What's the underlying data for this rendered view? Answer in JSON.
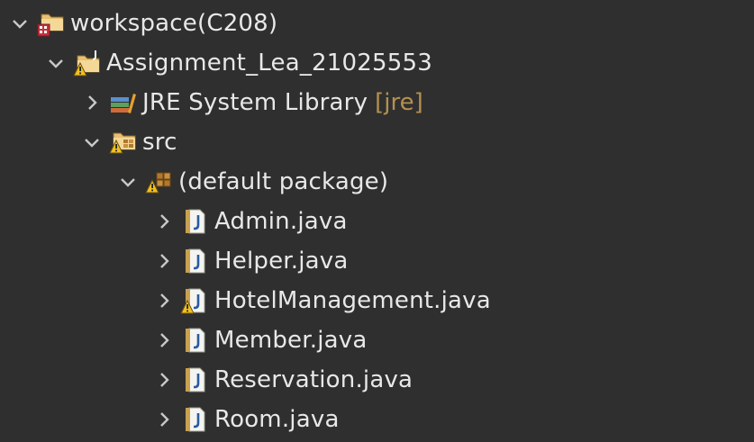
{
  "tree": {
    "workspace": {
      "label": "workspace(C208)",
      "expanded": true,
      "icon": "workspace-icon"
    },
    "project": {
      "label": "Assignment_Lea_21025553",
      "expanded": true,
      "icon": "java-project-warning-icon"
    },
    "jre": {
      "label": "JRE System Library",
      "decoration": "[jre]",
      "expanded": false,
      "icon": "library-icon"
    },
    "src": {
      "label": "src",
      "expanded": true,
      "icon": "source-folder-warning-icon"
    },
    "package": {
      "label": "(default package)",
      "expanded": true,
      "icon": "package-warning-icon"
    },
    "files": [
      {
        "label": "Admin.java",
        "warning": false,
        "icon": "java-file-icon"
      },
      {
        "label": "Helper.java",
        "warning": false,
        "icon": "java-file-icon"
      },
      {
        "label": "HotelManagement.java",
        "warning": true,
        "icon": "java-file-warning-icon"
      },
      {
        "label": "Member.java",
        "warning": false,
        "icon": "java-file-icon"
      },
      {
        "label": "Reservation.java",
        "warning": false,
        "icon": "java-file-icon"
      },
      {
        "label": "Room.java",
        "warning": false,
        "icon": "java-file-icon"
      }
    ]
  },
  "colors": {
    "background": "#2f2f2f",
    "text": "#e8e8e8",
    "decoration": "#b5904f",
    "chevron": "#c8c8c8"
  }
}
